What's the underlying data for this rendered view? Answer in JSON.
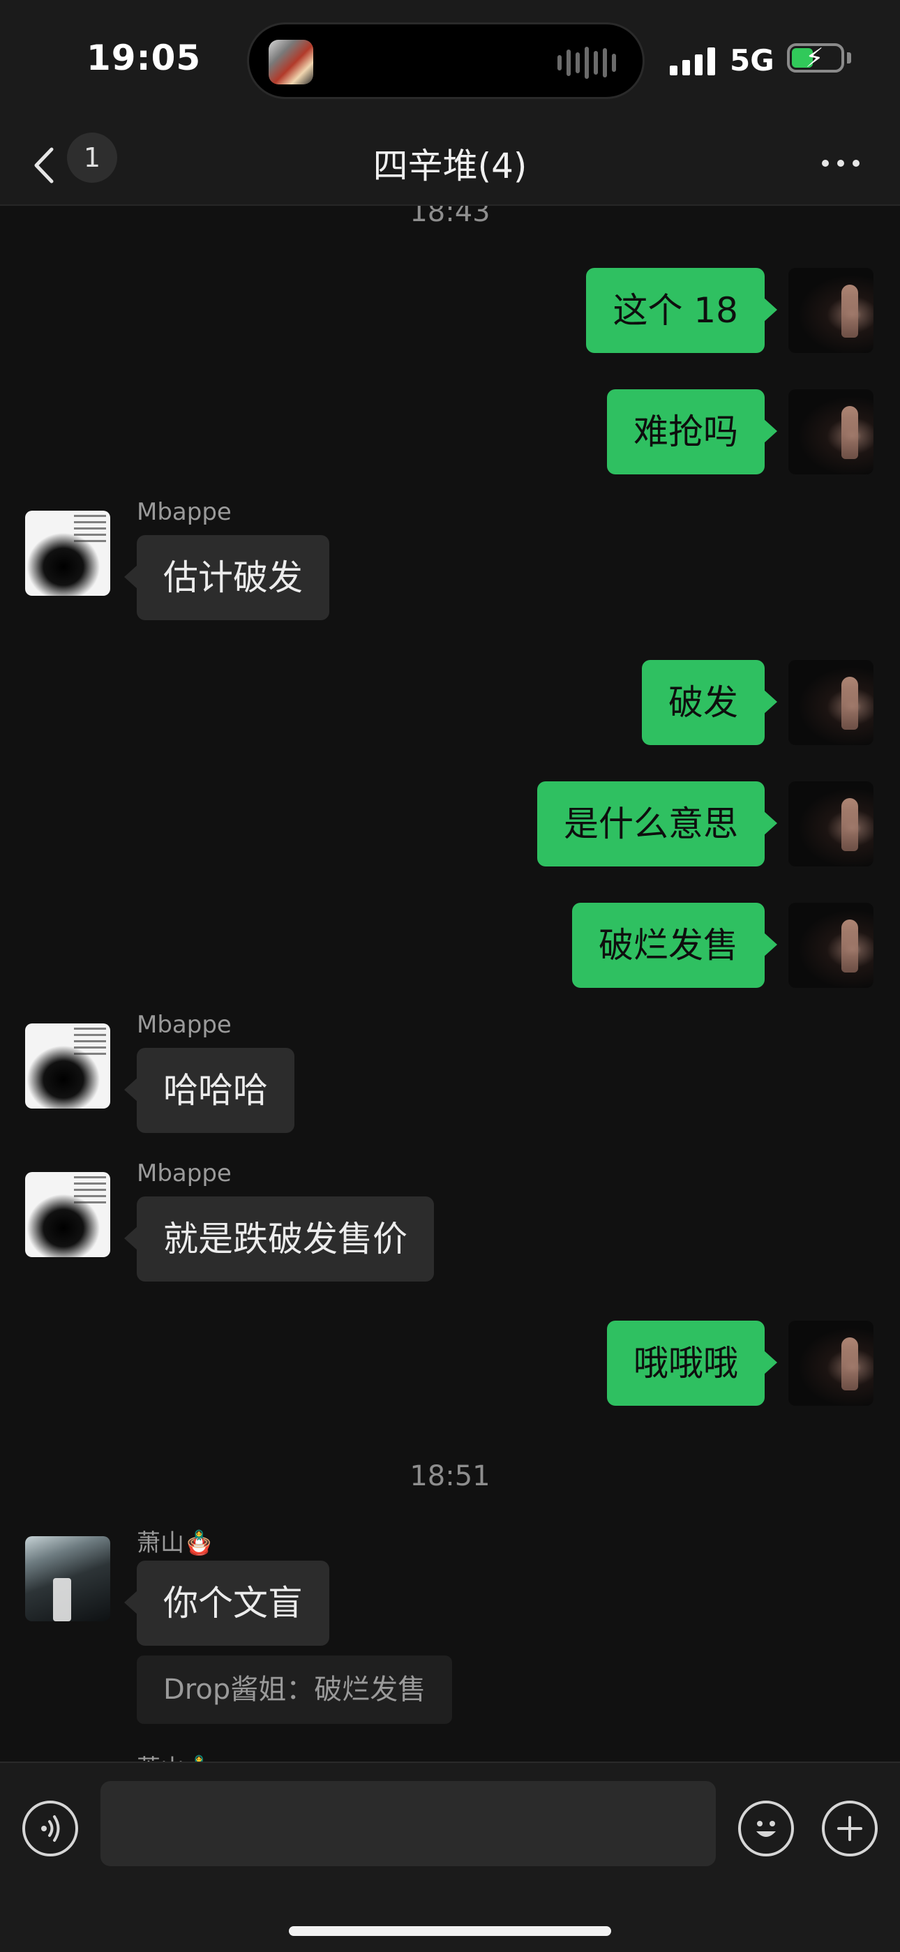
{
  "status": {
    "time": "19:05",
    "network": "5G"
  },
  "header": {
    "unread_count": "1",
    "title": "四辛堆(4)"
  },
  "chat": {
    "timestamp_top": "18:43",
    "messages": [
      {
        "dir": "out",
        "text": "这个 18"
      },
      {
        "dir": "out",
        "text": "难抢吗"
      },
      {
        "dir": "in",
        "sender": "Mbappe",
        "text": "估计破发"
      },
      {
        "dir": "out",
        "text": "破发"
      },
      {
        "dir": "out",
        "text": "是什么意思"
      },
      {
        "dir": "out",
        "text": "破烂发售"
      },
      {
        "dir": "in",
        "sender": "Mbappe",
        "text": "哈哈哈"
      },
      {
        "dir": "in",
        "sender": "Mbappe",
        "text": "就是跌破发售价"
      },
      {
        "dir": "out",
        "text": "哦哦哦"
      }
    ],
    "timestamp_2": "18:51",
    "xiaoshan": {
      "sender": "萧山🪆",
      "text": "你个文盲",
      "quote": "Drop酱姐：破烂发售",
      "next_sender": "萧山🪆"
    }
  },
  "input": {
    "placeholder": ""
  }
}
